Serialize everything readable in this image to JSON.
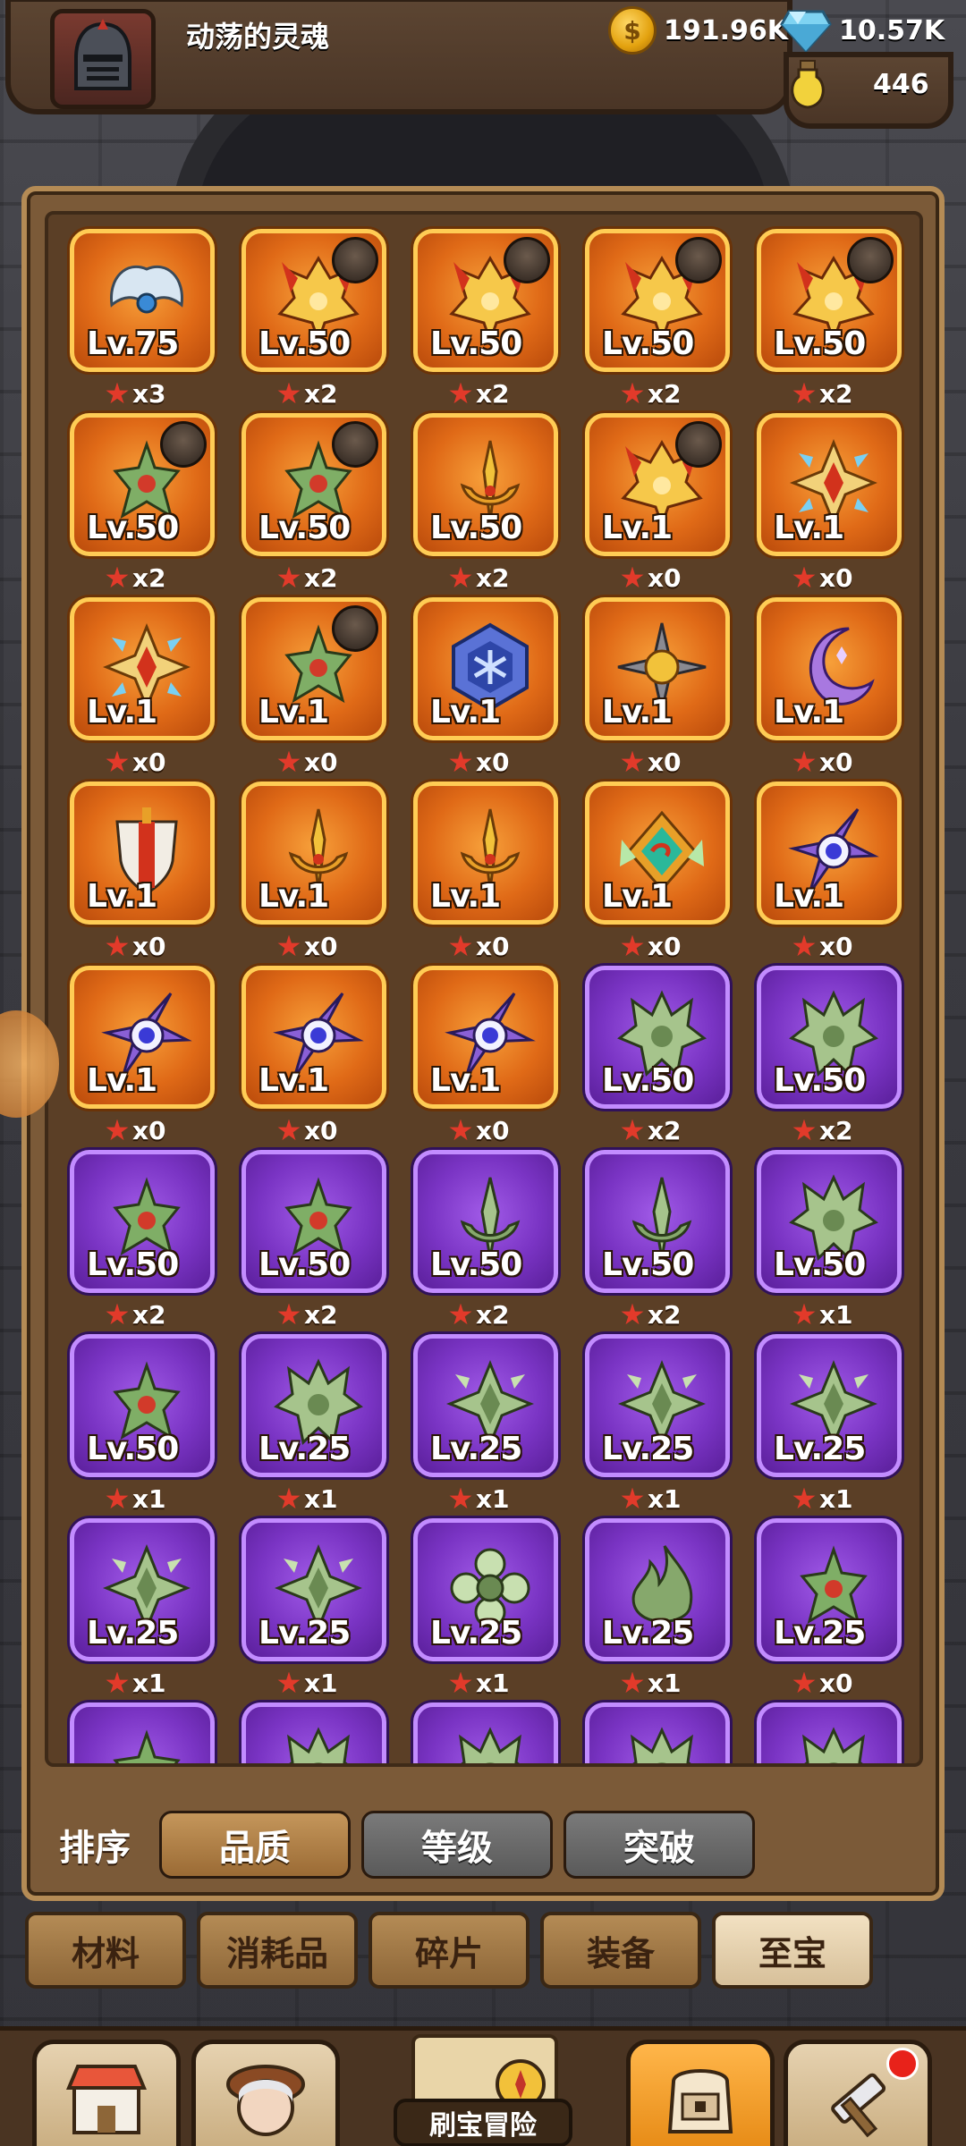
{
  "header": {
    "player_name": "动荡的灵魂",
    "gold": "191.96K",
    "gems": "10.57K",
    "potion": "446"
  },
  "inventory": {
    "items": [
      {
        "rarity": "orange",
        "level": "Lv.75",
        "count": "x3",
        "icon": "silver-wings-icon",
        "owner": false
      },
      {
        "rarity": "orange",
        "level": "Lv.50",
        "count": "x2",
        "icon": "golden-flame-crest-icon",
        "owner": true
      },
      {
        "rarity": "orange",
        "level": "Lv.50",
        "count": "x2",
        "icon": "golden-flame-crest-icon",
        "owner": true
      },
      {
        "rarity": "orange",
        "level": "Lv.50",
        "count": "x2",
        "icon": "golden-flame-crest-icon",
        "owner": true
      },
      {
        "rarity": "orange",
        "level": "Lv.50",
        "count": "x2",
        "icon": "golden-flame-crest-icon",
        "owner": true
      },
      {
        "rarity": "orange",
        "level": "Lv.50",
        "count": "x2",
        "icon": "green-leaf-crest-icon",
        "owner": true
      },
      {
        "rarity": "orange",
        "level": "Lv.50",
        "count": "x2",
        "icon": "green-leaf-crest-icon",
        "owner": true
      },
      {
        "rarity": "orange",
        "level": "Lv.50",
        "count": "x2",
        "icon": "golden-spear-icon",
        "owner": false
      },
      {
        "rarity": "orange",
        "level": "Lv.1",
        "count": "x0",
        "icon": "golden-flame-crest-icon",
        "owner": true
      },
      {
        "rarity": "orange",
        "level": "Lv.1",
        "count": "x0",
        "icon": "golden-cross-gem-icon",
        "owner": false
      },
      {
        "rarity": "orange",
        "level": "Lv.1",
        "count": "x0",
        "icon": "golden-cross-gem-icon",
        "owner": false
      },
      {
        "rarity": "orange",
        "level": "Lv.1",
        "count": "x0",
        "icon": "green-leaf-crest-icon",
        "owner": true
      },
      {
        "rarity": "orange",
        "level": "Lv.1",
        "count": "x0",
        "icon": "blue-hexagon-snowflake-icon",
        "owner": false
      },
      {
        "rarity": "orange",
        "level": "Lv.1",
        "count": "x0",
        "icon": "shuriken-star-icon",
        "owner": false
      },
      {
        "rarity": "orange",
        "level": "Lv.1",
        "count": "x0",
        "icon": "purple-crescent-icon",
        "owner": false
      },
      {
        "rarity": "orange",
        "level": "Lv.1",
        "count": "x0",
        "icon": "red-shield-sword-icon",
        "owner": false
      },
      {
        "rarity": "orange",
        "level": "Lv.1",
        "count": "x0",
        "icon": "golden-spear-icon",
        "owner": false
      },
      {
        "rarity": "orange",
        "level": "Lv.1",
        "count": "x0",
        "icon": "golden-spear-icon",
        "owner": false
      },
      {
        "rarity": "orange",
        "level": "Lv.1",
        "count": "x0",
        "icon": "emerald-wing-diamond-icon",
        "owner": false
      },
      {
        "rarity": "orange",
        "level": "Lv.1",
        "count": "x0",
        "icon": "purple-eye-blade-icon",
        "owner": false
      },
      {
        "rarity": "orange",
        "level": "Lv.1",
        "count": "x0",
        "icon": "purple-eye-blade-icon",
        "owner": false
      },
      {
        "rarity": "orange",
        "level": "Lv.1",
        "count": "x0",
        "icon": "purple-eye-blade-icon",
        "owner": false
      },
      {
        "rarity": "orange",
        "level": "Lv.1",
        "count": "x0",
        "icon": "purple-eye-blade-icon",
        "owner": false
      },
      {
        "rarity": "purple",
        "level": "Lv.50",
        "count": "x2",
        "icon": "green-spiked-crest-icon",
        "owner": false
      },
      {
        "rarity": "purple",
        "level": "Lv.50",
        "count": "x2",
        "icon": "green-spiked-crest-icon",
        "owner": false
      },
      {
        "rarity": "purple",
        "level": "Lv.50",
        "count": "x2",
        "icon": "green-leaf-crest-icon",
        "owner": false
      },
      {
        "rarity": "purple",
        "level": "Lv.50",
        "count": "x2",
        "icon": "green-leaf-crest-icon",
        "owner": false
      },
      {
        "rarity": "purple",
        "level": "Lv.50",
        "count": "x2",
        "icon": "green-spear-icon",
        "owner": false
      },
      {
        "rarity": "purple",
        "level": "Lv.50",
        "count": "x2",
        "icon": "green-spear-icon",
        "owner": false
      },
      {
        "rarity": "purple",
        "level": "Lv.50",
        "count": "x1",
        "icon": "green-spiked-crest-icon",
        "owner": false
      },
      {
        "rarity": "purple",
        "level": "Lv.50",
        "count": "x1",
        "icon": "green-leaf-crest-icon",
        "owner": false
      },
      {
        "rarity": "purple",
        "level": "Lv.25",
        "count": "x1",
        "icon": "green-spiked-crest-icon",
        "owner": false
      },
      {
        "rarity": "purple",
        "level": "Lv.25",
        "count": "x1",
        "icon": "green-cross-crest-icon",
        "owner": false
      },
      {
        "rarity": "purple",
        "level": "Lv.25",
        "count": "x1",
        "icon": "green-cross-crest-icon",
        "owner": false
      },
      {
        "rarity": "purple",
        "level": "Lv.25",
        "count": "x1",
        "icon": "green-cross-crest-icon",
        "owner": false
      },
      {
        "rarity": "purple",
        "level": "Lv.25",
        "count": "x1",
        "icon": "green-cross-crest-icon",
        "owner": false
      },
      {
        "rarity": "purple",
        "level": "Lv.25",
        "count": "x1",
        "icon": "green-cross-crest-icon",
        "owner": false
      },
      {
        "rarity": "purple",
        "level": "Lv.25",
        "count": "x1",
        "icon": "green-flower-icon",
        "owner": false
      },
      {
        "rarity": "purple",
        "level": "Lv.25",
        "count": "x1",
        "icon": "green-flame-icon",
        "owner": false
      },
      {
        "rarity": "purple",
        "level": "Lv.25",
        "count": "x0",
        "icon": "green-leaf-crest-icon",
        "owner": false
      },
      {
        "rarity": "purple",
        "level": "",
        "count": "",
        "icon": "green-leaf-crest-icon",
        "owner": false
      },
      {
        "rarity": "purple",
        "level": "",
        "count": "",
        "icon": "green-spiked-crest-icon",
        "owner": false
      },
      {
        "rarity": "purple",
        "level": "",
        "count": "",
        "icon": "green-spiked-crest-icon",
        "owner": false
      },
      {
        "rarity": "purple",
        "level": "",
        "count": "",
        "icon": "green-spiked-crest-icon",
        "owner": false
      },
      {
        "rarity": "purple",
        "level": "",
        "count": "",
        "icon": "green-spiked-crest-icon",
        "owner": false
      }
    ]
  },
  "sort": {
    "label": "排序",
    "options": [
      {
        "label": "品质",
        "active": true
      },
      {
        "label": "等级",
        "active": false
      },
      {
        "label": "突破",
        "active": false
      }
    ]
  },
  "categories": [
    {
      "label": "材料",
      "active": false
    },
    {
      "label": "消耗品",
      "active": false
    },
    {
      "label": "碎片",
      "active": false
    },
    {
      "label": "装备",
      "active": false
    },
    {
      "label": "至宝",
      "active": true
    }
  ],
  "bottom_nav": {
    "adventure_label": "刷宝冒险"
  },
  "colors": {
    "orange_tile": "#e06a17",
    "purple_tile": "#7a34c4",
    "panel": "#7b5a38",
    "star": "#e23a2a"
  }
}
